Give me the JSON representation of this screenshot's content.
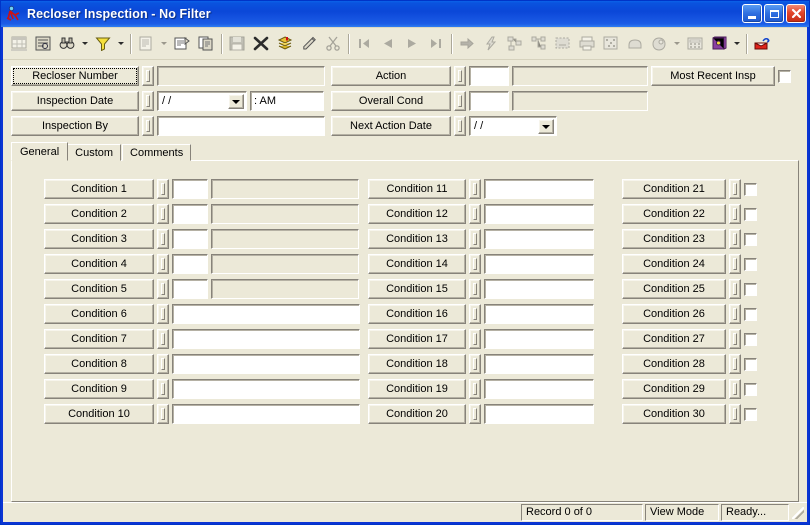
{
  "window": {
    "title": "Recloser Inspection - No Filter",
    "icon": "recloser-app-icon",
    "minimize_label": "Minimize",
    "maximize_label": "Maximize",
    "close_label": "Close"
  },
  "toolbar": {
    "groups": [
      {
        "items": [
          {
            "icon": "grid-view-icon",
            "disabled": true,
            "dropdown": false
          },
          {
            "icon": "form-view-icon",
            "disabled": false,
            "dropdown": false
          },
          {
            "icon": "find-binoculars-icon",
            "disabled": false,
            "dropdown": true
          },
          {
            "icon": "filter-funnel-icon",
            "disabled": false,
            "dropdown": true
          },
          {
            "icon": "report-icon",
            "disabled": true,
            "dropdown": true
          },
          {
            "icon": "properties-icon",
            "disabled": false,
            "dropdown": false
          },
          {
            "icon": "copy-record-icon",
            "disabled": false,
            "dropdown": false
          }
        ]
      },
      {
        "items": [
          {
            "icon": "save-icon",
            "disabled": true,
            "dropdown": false
          },
          {
            "icon": "delete-x-icon",
            "disabled": false,
            "dropdown": false
          },
          {
            "icon": "layers-stack-icon",
            "disabled": false,
            "dropdown": false
          },
          {
            "icon": "edit-pencil-icon",
            "disabled": false,
            "dropdown": false
          },
          {
            "icon": "cut-scissors-icon",
            "disabled": true,
            "dropdown": false
          }
        ]
      },
      {
        "items": [
          {
            "icon": "first-record-icon",
            "disabled": true,
            "dropdown": false
          },
          {
            "icon": "previous-record-icon",
            "disabled": true,
            "dropdown": false
          },
          {
            "icon": "next-record-icon",
            "disabled": true,
            "dropdown": false
          },
          {
            "icon": "last-record-icon",
            "disabled": true,
            "dropdown": false
          }
        ]
      },
      {
        "items": [
          {
            "icon": "goto-arrow-icon",
            "disabled": true,
            "dropdown": false
          },
          {
            "icon": "lightning-icon",
            "disabled": true,
            "dropdown": false
          },
          {
            "icon": "network-tree-icon",
            "disabled": true,
            "dropdown": false
          },
          {
            "icon": "hierarchy-icon",
            "disabled": true,
            "dropdown": false
          },
          {
            "icon": "select-dashed-icon",
            "disabled": true,
            "dropdown": false
          },
          {
            "icon": "print-icon",
            "disabled": true,
            "dropdown": false
          },
          {
            "icon": "scatter-points-icon",
            "disabled": true,
            "dropdown": false
          },
          {
            "icon": "polygon-shape-icon",
            "disabled": true,
            "dropdown": false
          },
          {
            "icon": "zoom-shape-icon",
            "disabled": true,
            "dropdown": true
          },
          {
            "icon": "calculator-icon",
            "disabled": true,
            "dropdown": false
          },
          {
            "icon": "lookup-book-icon",
            "disabled": false,
            "dropdown": true
          }
        ]
      },
      {
        "items": [
          {
            "icon": "redline-flag-icon",
            "disabled": false,
            "dropdown": false
          }
        ]
      }
    ]
  },
  "header": {
    "left_fields": [
      {
        "label": "Recloser Number",
        "type": "text",
        "value": "",
        "focused": true
      },
      {
        "label": "Inspection Date",
        "type": "date-time",
        "date_value": "  /  /",
        "time_value": ":     AM"
      },
      {
        "label": "Inspection By",
        "type": "text",
        "value": ""
      }
    ],
    "mid_fields": [
      {
        "label": "Action",
        "type": "code-desc",
        "code_value": "",
        "desc_value": ""
      },
      {
        "label": "Overall Cond",
        "type": "code-desc",
        "code_value": "",
        "desc_value": ""
      },
      {
        "label": "Next Action Date",
        "type": "date",
        "date_value": "  /  /"
      }
    ],
    "right": {
      "button_label": "Most Recent Insp",
      "checkbox_checked": false
    }
  },
  "tabs": [
    {
      "label": "General",
      "active": true
    },
    {
      "label": "Custom",
      "active": false
    },
    {
      "label": "Comments",
      "active": false
    }
  ],
  "conditions": {
    "col1": [
      {
        "label": "Condition 1",
        "type": "code-desc",
        "code_value": "",
        "desc_value": ""
      },
      {
        "label": "Condition 2",
        "type": "code-desc",
        "code_value": "",
        "desc_value": ""
      },
      {
        "label": "Condition 3",
        "type": "code-desc",
        "code_value": "",
        "desc_value": ""
      },
      {
        "label": "Condition 4",
        "type": "code-desc",
        "code_value": "",
        "desc_value": ""
      },
      {
        "label": "Condition 5",
        "type": "code-desc",
        "code_value": "",
        "desc_value": ""
      },
      {
        "label": "Condition 6",
        "type": "text",
        "value": ""
      },
      {
        "label": "Condition 7",
        "type": "text",
        "value": ""
      },
      {
        "label": "Condition 8",
        "type": "text",
        "value": ""
      },
      {
        "label": "Condition 9",
        "type": "text",
        "value": ""
      },
      {
        "label": "Condition 10",
        "type": "text",
        "value": ""
      }
    ],
    "col2": [
      {
        "label": "Condition 11",
        "type": "text",
        "value": ""
      },
      {
        "label": "Condition 12",
        "type": "text",
        "value": ""
      },
      {
        "label": "Condition 13",
        "type": "text",
        "value": ""
      },
      {
        "label": "Condition 14",
        "type": "text",
        "value": ""
      },
      {
        "label": "Condition 15",
        "type": "text",
        "value": ""
      },
      {
        "label": "Condition 16",
        "type": "text",
        "value": ""
      },
      {
        "label": "Condition 17",
        "type": "text",
        "value": ""
      },
      {
        "label": "Condition 18",
        "type": "text",
        "value": ""
      },
      {
        "label": "Condition 19",
        "type": "text",
        "value": ""
      },
      {
        "label": "Condition 20",
        "type": "text",
        "value": ""
      }
    ],
    "col3": [
      {
        "label": "Condition 21",
        "type": "checkbox",
        "checked": false
      },
      {
        "label": "Condition 22",
        "type": "checkbox",
        "checked": false
      },
      {
        "label": "Condition 23",
        "type": "checkbox",
        "checked": false
      },
      {
        "label": "Condition 24",
        "type": "checkbox",
        "checked": false
      },
      {
        "label": "Condition 25",
        "type": "checkbox",
        "checked": false
      },
      {
        "label": "Condition 26",
        "type": "checkbox",
        "checked": false
      },
      {
        "label": "Condition 27",
        "type": "checkbox",
        "checked": false
      },
      {
        "label": "Condition 28",
        "type": "checkbox",
        "checked": false
      },
      {
        "label": "Condition 29",
        "type": "checkbox",
        "checked": false
      },
      {
        "label": "Condition 30",
        "type": "checkbox",
        "checked": false
      }
    ]
  },
  "statusbar": {
    "record": "Record 0 of 0",
    "mode": "View Mode",
    "state": "Ready..."
  },
  "colors": {
    "title_blue": "#0b47d8",
    "face": "#ece9d8",
    "shadow": "#87837a",
    "close_red": "#c42d16"
  }
}
